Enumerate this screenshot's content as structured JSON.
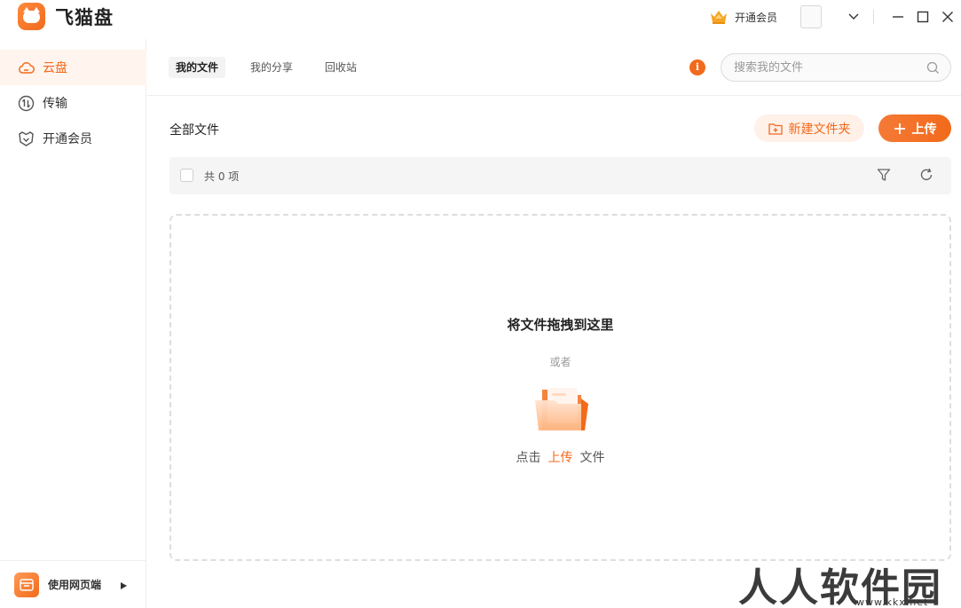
{
  "app": {
    "title": "飞猫盘"
  },
  "titlebar": {
    "vip_label": "开通会员"
  },
  "sidebar": {
    "items": [
      {
        "label": "云盘",
        "icon": "cloud-icon",
        "active": true
      },
      {
        "label": "传输",
        "icon": "transfer-icon",
        "active": false
      },
      {
        "label": "开通会员",
        "icon": "vip-shield-icon",
        "active": false
      }
    ],
    "footer_label": "使用网页端"
  },
  "tabs": [
    {
      "label": "我的文件",
      "active": true
    },
    {
      "label": "我的分享",
      "active": false
    },
    {
      "label": "回收站",
      "active": false
    }
  ],
  "search": {
    "placeholder": "搜索我的文件"
  },
  "content": {
    "title": "全部文件",
    "new_folder_label": "新建文件夹",
    "upload_label": "上传",
    "count_text": "共 0 项"
  },
  "dropzone": {
    "title": "将文件拖拽到这里",
    "or": "或者",
    "action_prefix": "点击",
    "action_link": "上传",
    "action_suffix": "文件"
  },
  "watermark": {
    "main": "人人软件园",
    "sub": "www.kkx.net"
  },
  "colors": {
    "accent": "#f26a1b",
    "accent_light": "#fff0e8",
    "active_bg": "#fff4ee"
  }
}
